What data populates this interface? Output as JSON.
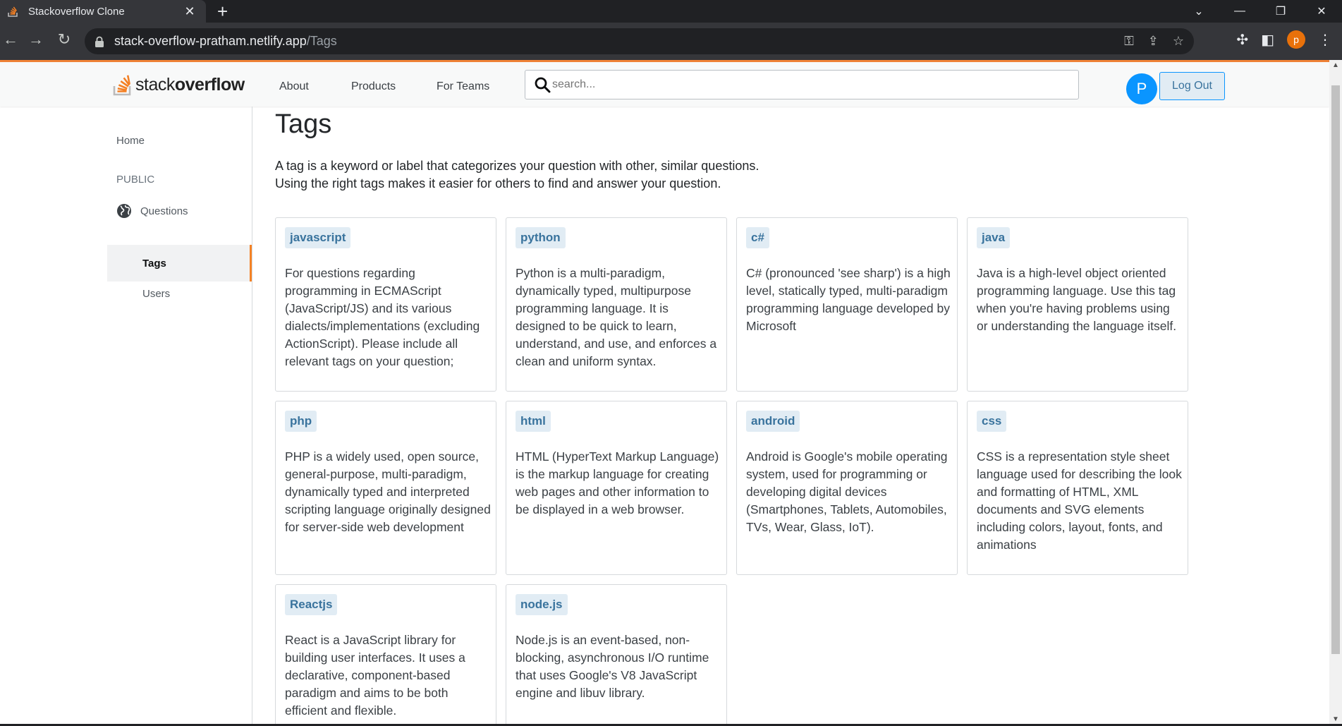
{
  "browser": {
    "tab_title": "Stackoverflow Clone",
    "tab_close": "✕",
    "new_tab": "+",
    "url_host": "stack-overflow-pratham.netlify.app",
    "url_path": "/Tags",
    "profile_initial": "p"
  },
  "header": {
    "logo_text_light": "stack",
    "logo_text_bold": "overflow",
    "nav": [
      "About",
      "Products",
      "For Teams"
    ],
    "search_placeholder": "search...",
    "avatar_initial": "P",
    "logout_label": "Log Out"
  },
  "sidebar": {
    "home": "Home",
    "public": "PUBLIC",
    "questions": "Questions",
    "tags": "Tags",
    "users": "Users"
  },
  "main": {
    "title": "Tags",
    "description_line1": "A tag is a keyword or label that categorizes your question with other, similar questions.",
    "description_line2": "Using the right tags makes it easier for others to find and answer your question.",
    "tags": [
      {
        "name": "javascript",
        "desc": "For questions regarding programming in ECMAScript (JavaScript/JS) and its various dialects/implementations (excluding ActionScript). Please include all relevant tags on your question;"
      },
      {
        "name": "python",
        "desc": "Python is a multi-paradigm, dynamically typed, multipurpose programming language. It is designed to be quick to learn, understand, and use, and enforces a clean and uniform syntax."
      },
      {
        "name": "c#",
        "desc": "C# (pronounced 'see sharp') is a high level, statically typed, multi-paradigm programming language developed by Microsoft"
      },
      {
        "name": "java",
        "desc": "Java is a high-level object oriented programming language. Use this tag when you're having problems using or understanding the language itself."
      },
      {
        "name": "php",
        "desc": "PHP is a widely used, open source, general-purpose, multi-paradigm, dynamically typed and interpreted scripting language originally designed for server-side web development"
      },
      {
        "name": "html",
        "desc": "HTML (HyperText Markup Language) is the markup language for creating web pages and other information to be displayed in a web browser."
      },
      {
        "name": "android",
        "desc": "Android is Google's mobile operating system, used for programming or developing digital devices (Smartphones, Tablets, Automobiles, TVs, Wear, Glass, IoT)."
      },
      {
        "name": "css",
        "desc": "CSS is a representation style sheet language used for describing the look and formatting of HTML, XML documents and SVG elements including colors, layout, fonts, and animations"
      },
      {
        "name": "Reactjs",
        "desc": "React is a JavaScript library for building user interfaces. It uses a declarative, component-based paradigm and aims to be both efficient and flexible."
      },
      {
        "name": "node.js",
        "desc": "Node.js is an event-based, non-blocking, asynchronous I/O runtime that uses Google's V8 JavaScript engine and libuv library."
      }
    ]
  },
  "colors": {
    "accent": "#f48225",
    "tag_bg": "#e1ecf4",
    "tag_text": "#39739d",
    "avatar": "#0a95ff"
  }
}
